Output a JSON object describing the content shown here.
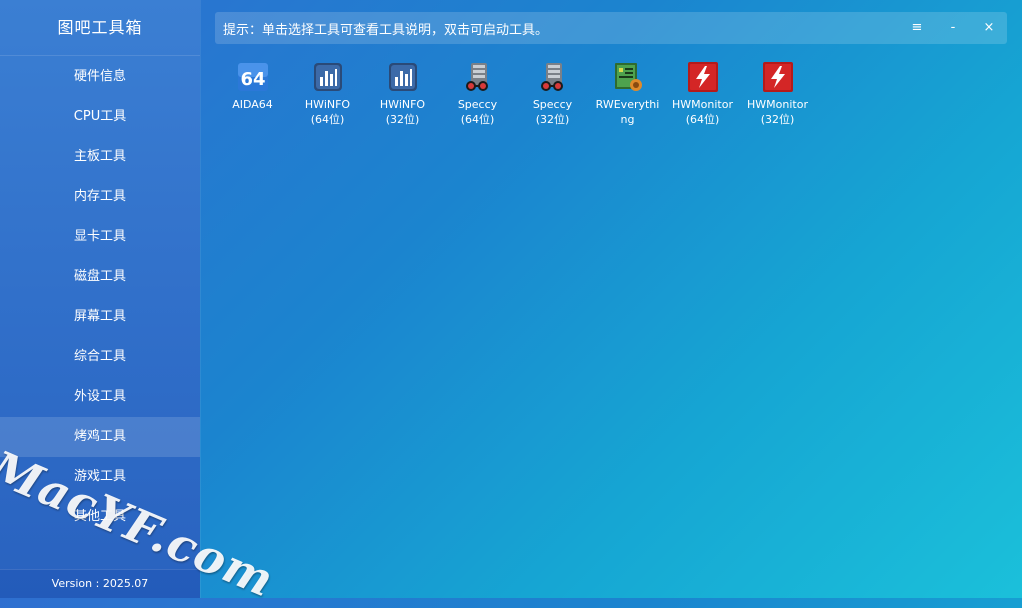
{
  "app": {
    "title": "图吧工具箱",
    "version": "Version : 2025.07"
  },
  "sidebar": {
    "items": [
      {
        "label": "硬件信息"
      },
      {
        "label": "CPU工具"
      },
      {
        "label": "主板工具"
      },
      {
        "label": "内存工具"
      },
      {
        "label": "显卡工具"
      },
      {
        "label": "磁盘工具"
      },
      {
        "label": "屏幕工具"
      },
      {
        "label": "综合工具"
      },
      {
        "label": "外设工具"
      },
      {
        "label": "烤鸡工具",
        "active": true
      },
      {
        "label": "游戏工具"
      },
      {
        "label": "其他工具"
      }
    ]
  },
  "hint": {
    "text": "提示：单击选择工具可查看工具说明，双击可启动工具。"
  },
  "window_controls": {
    "menu": "≡",
    "minimize": "-",
    "close": "×"
  },
  "tools": [
    {
      "name": "AIDA64",
      "sub": "",
      "icon": "aida64-icon"
    },
    {
      "name": "HWiNFO",
      "sub": "(64位)",
      "icon": "hwinfo-icon"
    },
    {
      "name": "HWiNFO",
      "sub": "(32位)",
      "icon": "hwinfo-icon"
    },
    {
      "name": "Speccy",
      "sub": "(64位)",
      "icon": "speccy-icon"
    },
    {
      "name": "Speccy",
      "sub": "(32位)",
      "icon": "speccy-icon"
    },
    {
      "name": "RWEverythi",
      "sub": "ng",
      "icon": "rweverything-icon"
    },
    {
      "name": "HWMonitor",
      "sub": "(64位)",
      "icon": "hwmonitor-icon"
    },
    {
      "name": "HWMonitor",
      "sub": "(32位)",
      "icon": "hwmonitor-icon"
    }
  ],
  "watermark": "MacYF.com"
}
